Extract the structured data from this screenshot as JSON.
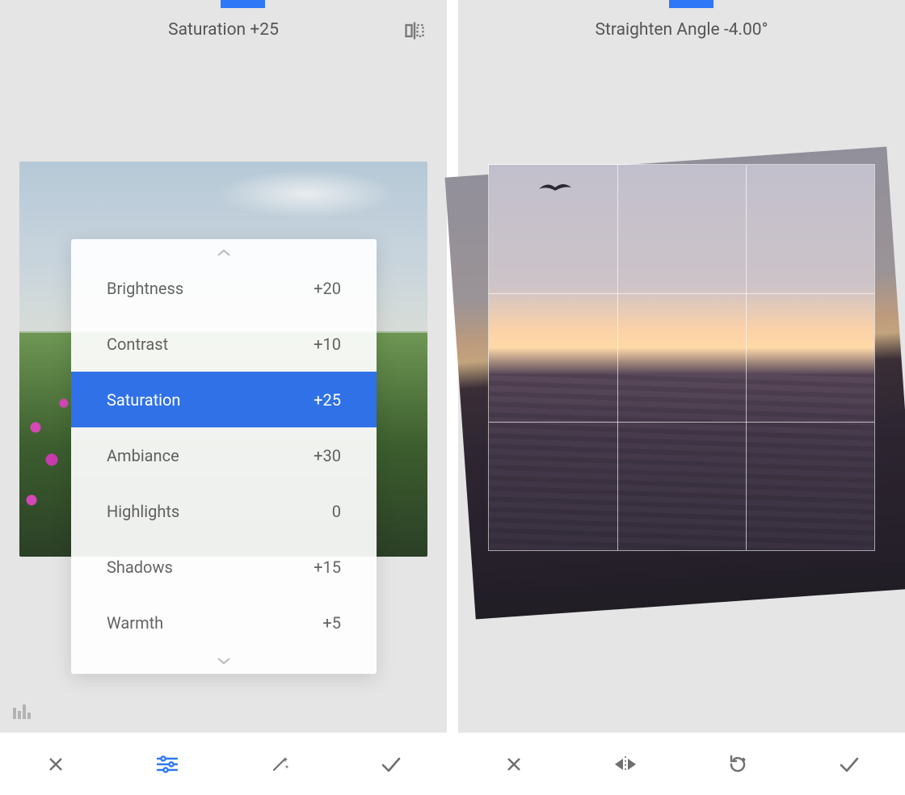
{
  "left": {
    "header": {
      "title": "Saturation +25"
    },
    "adjustments": [
      {
        "label": "Brightness",
        "value": "+20",
        "selected": false
      },
      {
        "label": "Contrast",
        "value": "+10",
        "selected": false
      },
      {
        "label": "Saturation",
        "value": "+25",
        "selected": true
      },
      {
        "label": "Ambiance",
        "value": "+30",
        "selected": false
      },
      {
        "label": "Highlights",
        "value": "0",
        "selected": false
      },
      {
        "label": "Shadows",
        "value": "+15",
        "selected": false
      },
      {
        "label": "Warmth",
        "value": "+5",
        "selected": false
      }
    ],
    "toolbar": {
      "close": "close-icon",
      "sliders": "adjust-sliders-icon",
      "autofix": "magic-wand-icon",
      "confirm": "check-icon",
      "active": "sliders"
    },
    "icons": {
      "compare": "compare-icon",
      "histogram": "histogram-icon"
    },
    "accent_color": "#2e78f7"
  },
  "right": {
    "header": {
      "title": "Straighten Angle -4.00°"
    },
    "angle_deg": -4.0,
    "toolbar": {
      "close": "close-icon",
      "flip": "flip-horizontal-icon",
      "rotate": "rotate-ccw-icon",
      "confirm": "check-icon"
    },
    "accent_color": "#2e78f7"
  }
}
